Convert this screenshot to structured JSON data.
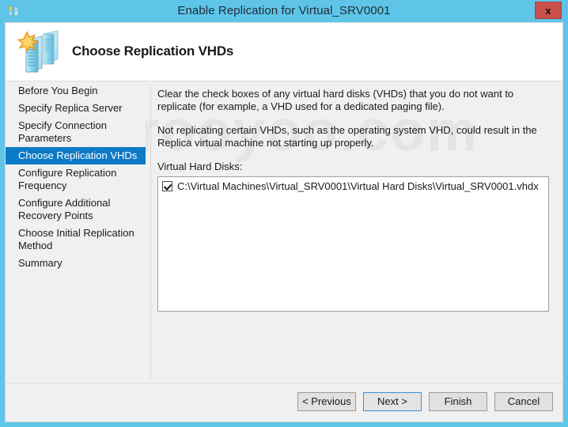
{
  "window": {
    "title": "Enable Replication for Virtual_SRV0001",
    "close_label": "x",
    "titlebar_color": "#5ec5e8",
    "accent_color": "#0c7ac6"
  },
  "header": {
    "title": "Choose Replication VHDs",
    "icon": "replication-servers-icon"
  },
  "watermark": {
    "text": "firooyoo.com"
  },
  "sidebar": {
    "items": [
      {
        "label": "Before You Begin",
        "selected": false
      },
      {
        "label": "Specify Replica Server",
        "selected": false
      },
      {
        "label": "Specify Connection Parameters",
        "selected": false
      },
      {
        "label": "Choose Replication VHDs",
        "selected": true
      },
      {
        "label": "Configure Replication Frequency",
        "selected": false
      },
      {
        "label": "Configure Additional Recovery Points",
        "selected": false
      },
      {
        "label": "Choose Initial Replication Method",
        "selected": false
      },
      {
        "label": "Summary",
        "selected": false
      }
    ]
  },
  "main": {
    "paragraph_1": "Clear the check boxes of any virtual hard disks (VHDs) that you do not want to replicate (for example, a VHD used for a dedicated paging file).",
    "paragraph_2": "Not replicating certain VHDs, such as the operating system VHD, could result in the Replica virtual machine not starting up properly.",
    "list_label": "Virtual Hard Disks:",
    "vhd_list": [
      {
        "path": "C:\\Virtual Machines\\Virtual_SRV0001\\Virtual Hard Disks\\Virtual_SRV0001.vhdx",
        "checked": true
      }
    ]
  },
  "footer": {
    "buttons": [
      {
        "label": "< Previous",
        "default": false
      },
      {
        "label": "Next >",
        "default": true
      },
      {
        "label": "Finish",
        "default": false
      },
      {
        "label": "Cancel",
        "default": false
      }
    ]
  }
}
